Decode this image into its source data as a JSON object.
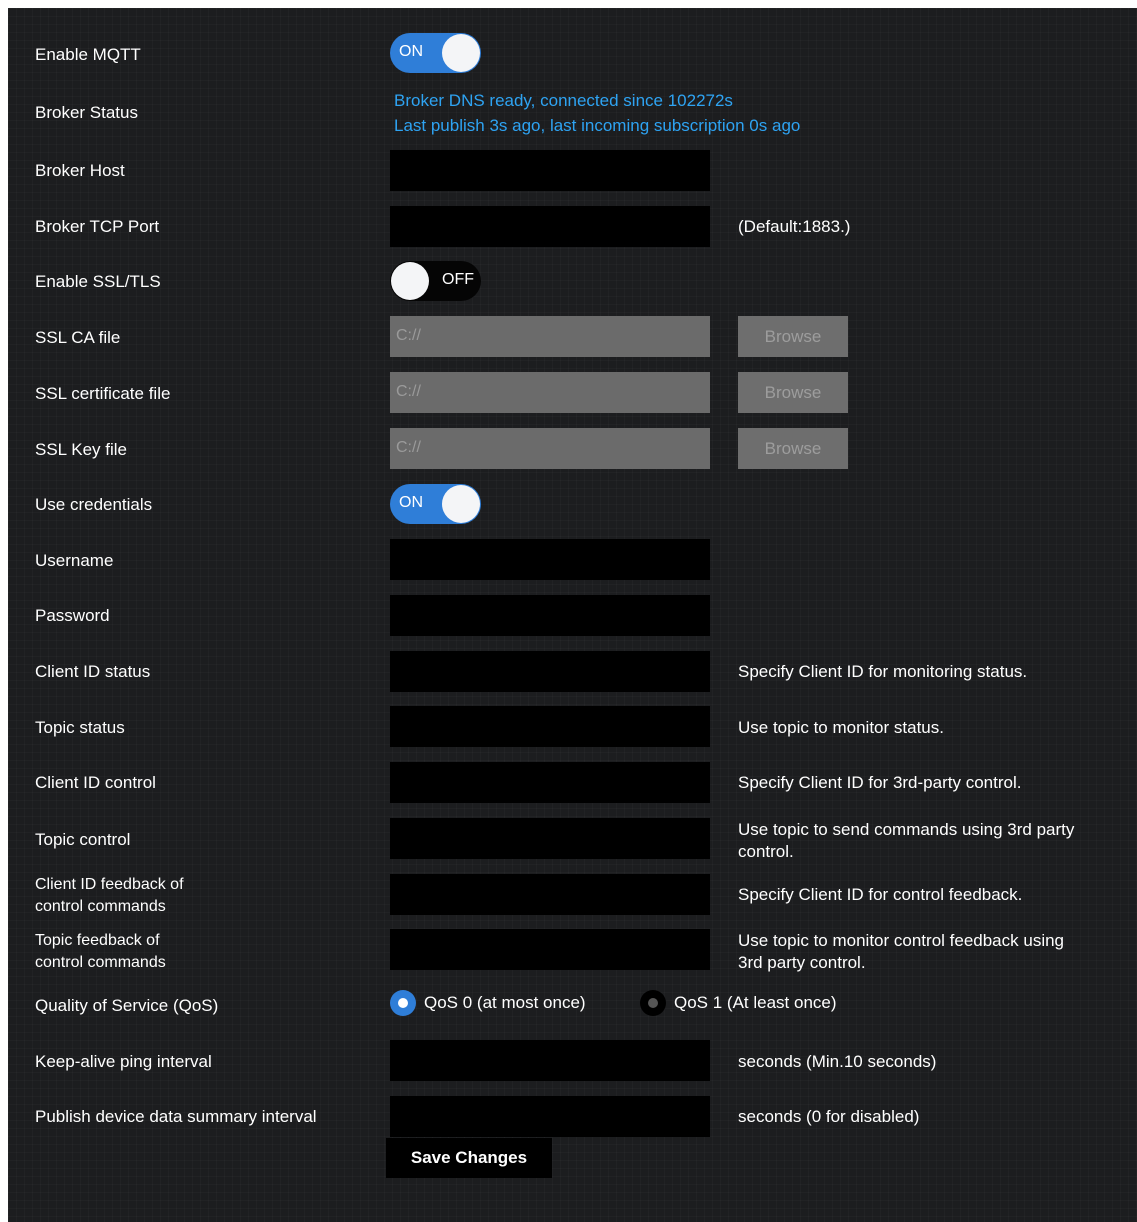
{
  "mqtt": {
    "label": "Enable MQTT",
    "toggle": "ON"
  },
  "broker_status": {
    "label": "Broker Status",
    "line1": "Broker DNS ready, connected since 102272s",
    "line2": "Last publish 3s ago, last incoming subscription 0s ago"
  },
  "broker_host": {
    "label": "Broker Host",
    "value": ""
  },
  "broker_port": {
    "label": "Broker TCP Port",
    "value": "",
    "hint": "(Default:1883.)"
  },
  "ssl": {
    "label": "Enable SSL/TLS",
    "toggle": "OFF"
  },
  "ssl_ca": {
    "label": "SSL CA file",
    "placeholder": "C://",
    "button": "Browse"
  },
  "ssl_cert": {
    "label": "SSL certificate file",
    "placeholder": "C://",
    "button": "Browse"
  },
  "ssl_key": {
    "label": "SSL Key file",
    "placeholder": "C://",
    "button": "Browse"
  },
  "credentials": {
    "label": "Use credentials",
    "toggle": "ON"
  },
  "username": {
    "label": "Username",
    "value": ""
  },
  "password": {
    "label": "Password",
    "value": ""
  },
  "client_id_status": {
    "label": "Client ID status",
    "hint": "Specify Client ID for monitoring status."
  },
  "topic_status": {
    "label": "Topic status",
    "hint": "Use topic to monitor status."
  },
  "client_id_control": {
    "label": "Client ID control",
    "hint": "Specify Client ID for 3rd-party control."
  },
  "topic_control": {
    "label": "Topic control",
    "hint_line1": "Use topic to send commands using 3rd party",
    "hint_line2": "control."
  },
  "client_id_feedback": {
    "label_line1": "Client ID feedback of",
    "label_line2": "control commands",
    "hint": "Specify Client ID for control feedback."
  },
  "topic_feedback": {
    "label_line1": "Topic feedback of",
    "label_line2": "control commands",
    "hint_line1": "Use topic to monitor control feedback using",
    "hint_line2": "3rd party control."
  },
  "qos": {
    "label": "Quality of Service (QoS)",
    "options": [
      "QoS 0 (at most once)",
      "QoS 1 (At least once)"
    ],
    "selected": "QoS 0 (at most once)"
  },
  "keepalive": {
    "label": "Keep-alive ping interval",
    "hint": "seconds (Min.10 seconds)"
  },
  "publish_interval": {
    "label": "Publish device data summary interval",
    "hint": "seconds (0 for disabled)"
  },
  "save_label": "Save Changes",
  "colors": {
    "accent": "#2f7ed8",
    "status_text": "#2ea3f2",
    "background": "#1c1d1f"
  }
}
